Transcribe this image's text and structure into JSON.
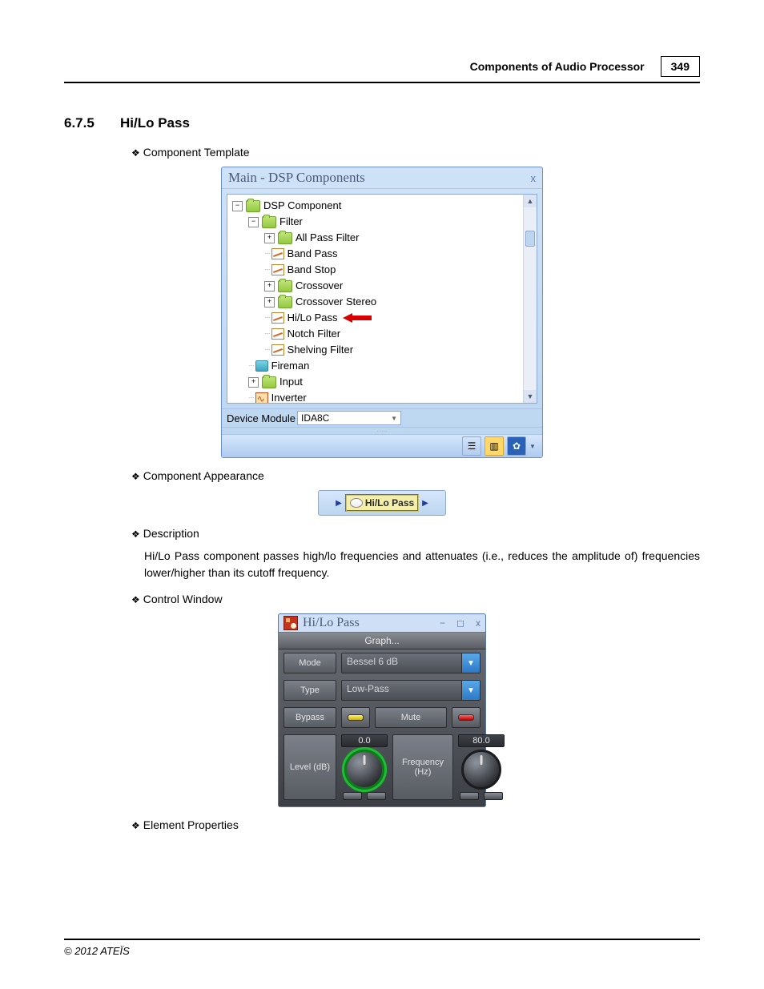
{
  "header": {
    "title": "Components of Audio Processor",
    "page": "349"
  },
  "section": {
    "num": "6.7.5",
    "title": "Hi/Lo Pass"
  },
  "subheads": {
    "template": "Component Template",
    "appearance": "Component Appearance",
    "description": "Description",
    "control": "Control Window",
    "elemprops": "Element Properties"
  },
  "tree": {
    "title": "Main - DSP Components",
    "root": "DSP Component",
    "filter": "Filter",
    "items": {
      "allpass": "All Pass Filter",
      "bandpass": "Band Pass",
      "bandstop": "Band Stop",
      "crossover": "Crossover",
      "crossover_st": "Crossover Stereo",
      "hilo": "Hi/Lo Pass",
      "notch": "Notch Filter",
      "shelving": "Shelving Filter"
    },
    "fireman": "Fireman",
    "input": "Input",
    "inverter": "Inverter",
    "device_label": "Device Module",
    "device_value": "IDA8C"
  },
  "appearance": {
    "label": "Hi/Lo Pass"
  },
  "description": "Hi/Lo Pass component passes high/lo frequencies and attenuates (i.e., reduces the amplitude of) frequencies lower/higher than its cutoff frequency.",
  "control": {
    "title": "Hi/Lo Pass",
    "graph": "Graph...",
    "labels": {
      "mode": "Mode",
      "type": "Type",
      "bypass": "Bypass",
      "mute": "Mute",
      "level": "Level (dB)",
      "freq": "Frequency (Hz)"
    },
    "values": {
      "mode": "Bessel 6 dB",
      "type": "Low-Pass",
      "level": "0.0",
      "freq": "80.0"
    }
  },
  "footer": "© 2012 ATEÏS"
}
